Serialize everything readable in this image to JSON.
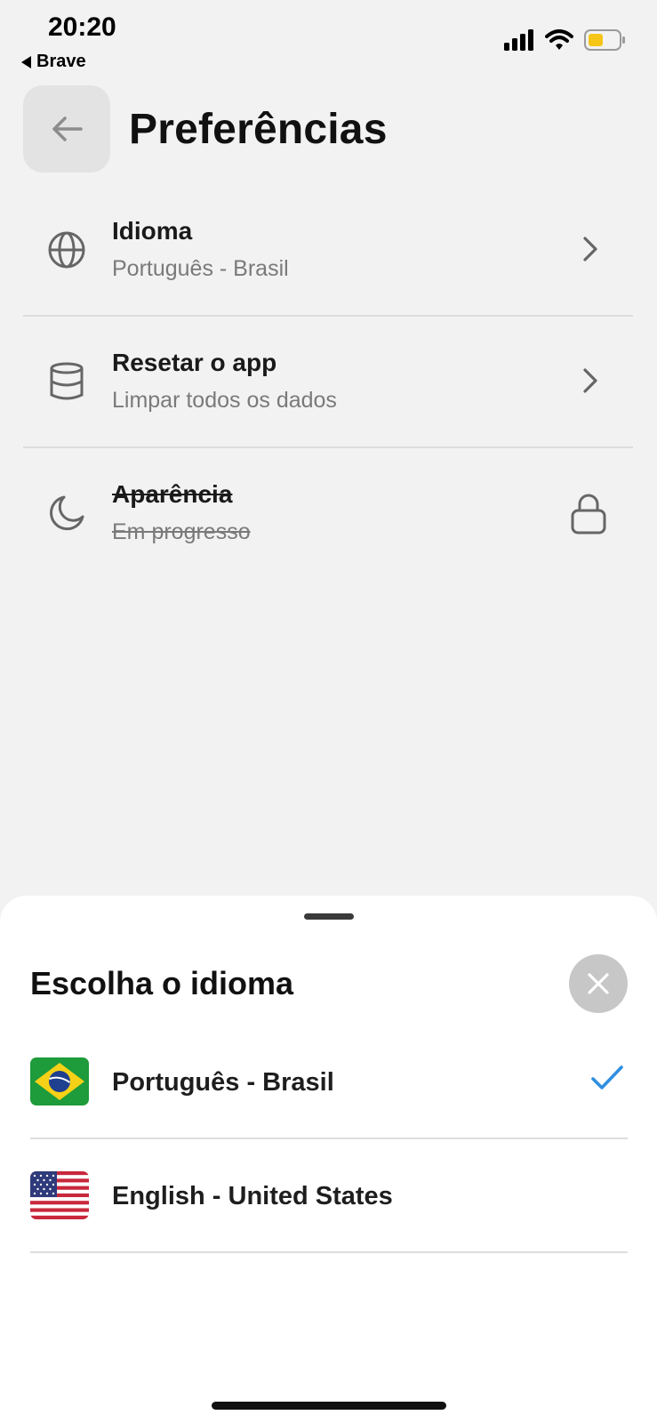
{
  "status_bar": {
    "time": "20:20",
    "back_app": "Brave",
    "icons": [
      "cellular-signal-icon",
      "wifi-icon",
      "battery-icon"
    ],
    "battery_color": "#f5c518"
  },
  "header": {
    "back_icon": "arrow-left-icon",
    "title": "Preferências"
  },
  "settings": [
    {
      "icon": "globe-icon",
      "title": "Idioma",
      "subtitle": "Português - Brasil",
      "trailing": "chevron-right-icon"
    },
    {
      "icon": "database-icon",
      "title": "Resetar o app",
      "subtitle": "Limpar todos os dados",
      "trailing": "chevron-right-icon"
    },
    {
      "icon": "moon-icon",
      "title": "Aparência",
      "subtitle": "Em progresso",
      "trailing": "lock-icon",
      "disabled": true
    }
  ],
  "language_sheet": {
    "title": "Escolha o idioma",
    "close_icon": "close-icon",
    "options": [
      {
        "flag": "brazil-flag-icon",
        "label": "Português - Brasil",
        "selected": true
      },
      {
        "flag": "usa-flag-icon",
        "label": "English - United States",
        "selected": false
      }
    ],
    "accent_color": "#2f8fe0"
  }
}
